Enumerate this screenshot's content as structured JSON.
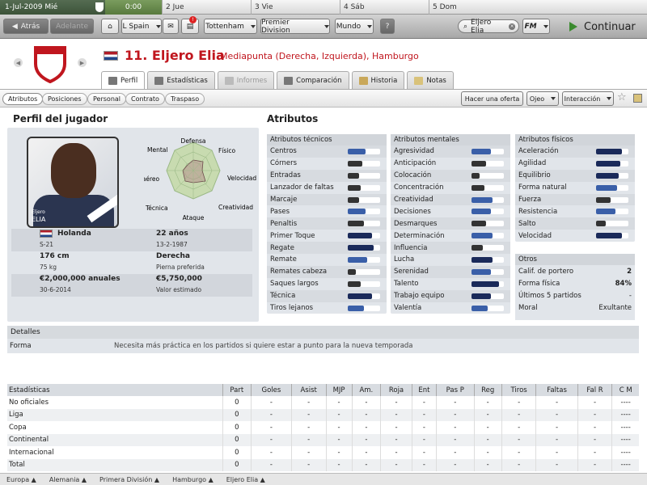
{
  "calendar": {
    "current_date": "1-Jul-2009  Mié",
    "time": "0:00",
    "days": [
      {
        "label": "2  Jue"
      },
      {
        "label": "3  Vie"
      },
      {
        "label": "4  Sáb"
      },
      {
        "label": "5  Dom"
      }
    ]
  },
  "toolbar": {
    "back": "Atrás",
    "forward": "Adelante",
    "nation": "L Spain",
    "club": "Tottenham",
    "competition": "Premier Division",
    "world": "Mundo",
    "help": "?",
    "search_value": "Eljero Elia",
    "fm_menu": "FM",
    "notification_count": "!",
    "continue": "Continuar"
  },
  "player": {
    "number_name": "11. Eljero Elia",
    "position_club": "Mediapunta (Derecha, Izquierda), Hamburgo"
  },
  "tabs": [
    {
      "label": "Perfil"
    },
    {
      "label": "Estadísticas"
    },
    {
      "label": "Informes"
    },
    {
      "label": "Comparación"
    },
    {
      "label": "Historia"
    },
    {
      "label": "Notas"
    }
  ],
  "subtabs": [
    {
      "label": "Atributos"
    },
    {
      "label": "Posiciones"
    },
    {
      "label": "Personal"
    },
    {
      "label": "Contrato"
    },
    {
      "label": "Traspaso"
    }
  ],
  "actions": {
    "offer": "Hacer una oferta",
    "scout": "Ojeo",
    "interaction": "Interacción"
  },
  "profile": {
    "heading": "Perfil del jugador",
    "photo_caption_small": "Eljero",
    "photo_caption": "ELIA",
    "nationality": "Holanda",
    "national_level": "S-21",
    "age": "22 años",
    "birth_date": "13-2-1987",
    "height": "176 cm",
    "weight": "75 kg",
    "foot": "Derecha",
    "foot_label": "Pierna preferida",
    "wage": "€2,000,000 anuales",
    "contract_end": "30-6-2014",
    "value": "€5,750,000",
    "value_label": "Valor estimado",
    "radar_labels": {
      "top": "Defensa",
      "top_right": "Físico",
      "right": "Velocidad",
      "bottom_right": "Creatividad",
      "bottom": "Ataque",
      "bottom_left": "Técnica",
      "left": "3o aéreo",
      "top_left": "Mental"
    }
  },
  "attributes": {
    "heading": "Atributos",
    "technical": {
      "title": "Atributos técnicos",
      "items": [
        {
          "label": "Centros",
          "level": 0.55,
          "color": "#3a5fa8"
        },
        {
          "label": "Córners",
          "level": 0.45,
          "color": "#333333"
        },
        {
          "label": "Entradas",
          "level": 0.35,
          "color": "#333333"
        },
        {
          "label": "Lanzador de faltas",
          "level": 0.4,
          "color": "#333333"
        },
        {
          "label": "Marcaje",
          "level": 0.35,
          "color": "#333333"
        },
        {
          "label": "Pases",
          "level": 0.55,
          "color": "#3a5fa8"
        },
        {
          "label": "Penaltis",
          "level": 0.5,
          "color": "#333333"
        },
        {
          "label": "Primer Toque",
          "level": 0.75,
          "color": "#1a2a5a"
        },
        {
          "label": "Regate",
          "level": 0.8,
          "color": "#1a2a5a"
        },
        {
          "label": "Remate",
          "level": 0.6,
          "color": "#3a5fa8"
        },
        {
          "label": "Remates cabeza",
          "level": 0.25,
          "color": "#333333"
        },
        {
          "label": "Saques largos",
          "level": 0.4,
          "color": "#333333"
        },
        {
          "label": "Técnica",
          "level": 0.75,
          "color": "#1a2a5a"
        },
        {
          "label": "Tiros lejanos",
          "level": 0.5,
          "color": "#3a5fa8"
        }
      ]
    },
    "mental": {
      "title": "Atributos mentales",
      "items": [
        {
          "label": "Agresividad",
          "level": 0.6,
          "color": "#3a5fa8"
        },
        {
          "label": "Anticipación",
          "level": 0.45,
          "color": "#333333"
        },
        {
          "label": "Colocación",
          "level": 0.25,
          "color": "#333333"
        },
        {
          "label": "Concentración",
          "level": 0.4,
          "color": "#333333"
        },
        {
          "label": "Creatividad",
          "level": 0.65,
          "color": "#3a5fa8"
        },
        {
          "label": "Decisiones",
          "level": 0.6,
          "color": "#3a5fa8"
        },
        {
          "label": "Desmarques",
          "level": 0.45,
          "color": "#333333"
        },
        {
          "label": "Determinación",
          "level": 0.65,
          "color": "#3a5fa8"
        },
        {
          "label": "Influencia",
          "level": 0.35,
          "color": "#333333"
        },
        {
          "label": "Lucha",
          "level": 0.65,
          "color": "#1a2a5a"
        },
        {
          "label": "Serenidad",
          "level": 0.6,
          "color": "#3a5fa8"
        },
        {
          "label": "Talento",
          "level": 0.85,
          "color": "#1a2a5a"
        },
        {
          "label": "Trabajo equipo",
          "level": 0.6,
          "color": "#1a2a5a"
        },
        {
          "label": "Valentía",
          "level": 0.5,
          "color": "#3a5fa8"
        }
      ]
    },
    "physical": {
      "title": "Atributos físicos",
      "items": [
        {
          "label": "Aceleración",
          "level": 0.8,
          "color": "#1a2a5a"
        },
        {
          "label": "Agilidad",
          "level": 0.75,
          "color": "#1a2a5a"
        },
        {
          "label": "Equilibrio",
          "level": 0.7,
          "color": "#1a2a5a"
        },
        {
          "label": "Forma natural",
          "level": 0.65,
          "color": "#3a5fa8"
        },
        {
          "label": "Fuerza",
          "level": 0.45,
          "color": "#333333"
        },
        {
          "label": "Resistencia",
          "level": 0.6,
          "color": "#3a5fa8"
        },
        {
          "label": "Salto",
          "level": 0.3,
          "color": "#333333"
        },
        {
          "label": "Velocidad",
          "level": 0.8,
          "color": "#1a2a5a"
        }
      ]
    },
    "others": {
      "title": "Otros",
      "items": [
        {
          "label": "Calif. de portero",
          "value": "2"
        },
        {
          "label": "Forma física",
          "value": "84%"
        },
        {
          "label": "Últimos 5 partidos",
          "value": "-"
        },
        {
          "label": "Moral",
          "value": "Exultante"
        }
      ]
    }
  },
  "details": {
    "title": "Detalles",
    "label": "Forma",
    "text": "Necesita más práctica en los partidos si quiere estar a punto para la nueva temporada"
  },
  "stats": {
    "headers": [
      "Estadísticas",
      "Part",
      "Goles",
      "Asist",
      "MJP",
      "Am.",
      "Roja",
      "Ent",
      "Pas P",
      "Reg",
      "Tiros",
      "Faltas",
      "Fal R",
      "C M"
    ],
    "rows": [
      [
        "No oficiales",
        "0",
        "-",
        "-",
        "-",
        "-",
        "-",
        "-",
        "-",
        "-",
        "-",
        "-",
        "-",
        "----"
      ],
      [
        "Liga",
        "0",
        "-",
        "-",
        "-",
        "-",
        "-",
        "-",
        "-",
        "-",
        "-",
        "-",
        "-",
        "----"
      ],
      [
        "Copa",
        "0",
        "-",
        "-",
        "-",
        "-",
        "-",
        "-",
        "-",
        "-",
        "-",
        "-",
        "-",
        "----"
      ],
      [
        "Continental",
        "0",
        "-",
        "-",
        "-",
        "-",
        "-",
        "-",
        "-",
        "-",
        "-",
        "-",
        "-",
        "----"
      ],
      [
        "Internacional",
        "0",
        "-",
        "-",
        "-",
        "-",
        "-",
        "-",
        "-",
        "-",
        "-",
        "-",
        "-",
        "----"
      ],
      [
        "Total",
        "0",
        "-",
        "-",
        "-",
        "-",
        "-",
        "-",
        "-",
        "-",
        "-",
        "-",
        "-",
        "----"
      ]
    ]
  },
  "breadcrumbs": [
    {
      "label": "Europa ▲"
    },
    {
      "label": "Alemania ▲"
    },
    {
      "label": "Primera División ▲"
    },
    {
      "label": "Hamburgo ▲"
    },
    {
      "label": "Eljero Elia ▲"
    }
  ]
}
